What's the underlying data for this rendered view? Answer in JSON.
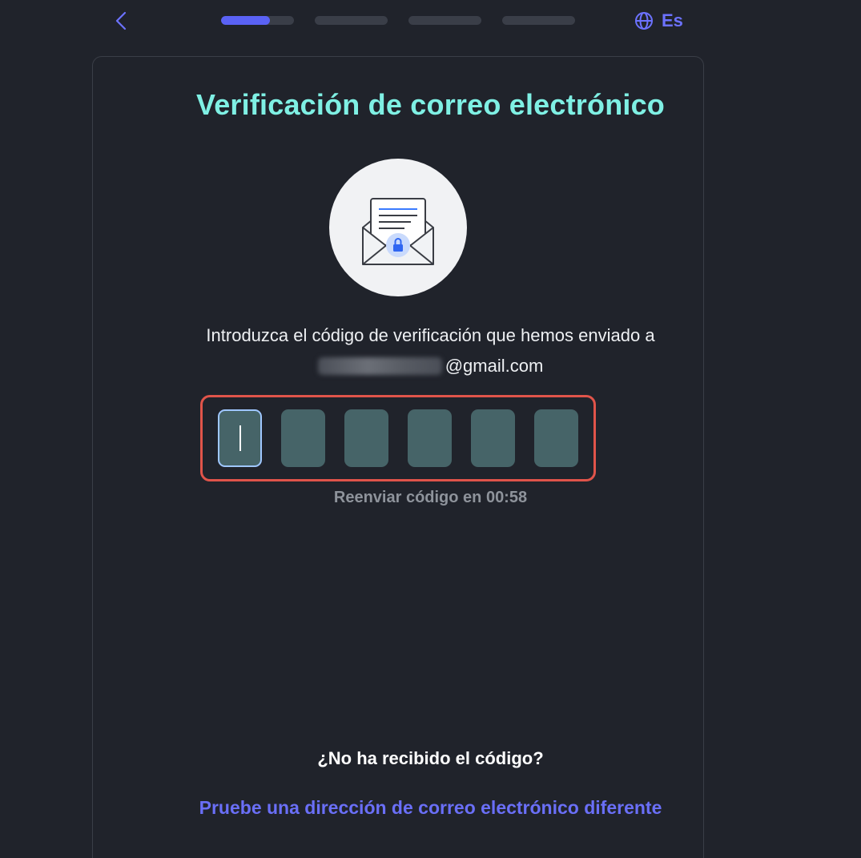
{
  "header": {
    "progress": {
      "total_steps": 4,
      "current_step": 1,
      "current_step_fill": 0.67
    },
    "language_label": "Es"
  },
  "card": {
    "title": "Verificación de correo electrónico",
    "instruction_text": "Introduzca el código de verificación que hemos enviado a",
    "email_visible_part": "@gmail.com",
    "code_length": 6,
    "resend_text": "Reenviar código en 00:58",
    "no_code_question": "¿No ha recibido el código?",
    "try_other_link": "Pruebe una dirección de correo electrónico diferente"
  },
  "colors": {
    "background": "#20232b",
    "accent": "#5a62f5",
    "title": "#7ff0e4",
    "code_box": "#466468",
    "highlight_border": "#e0544a"
  }
}
